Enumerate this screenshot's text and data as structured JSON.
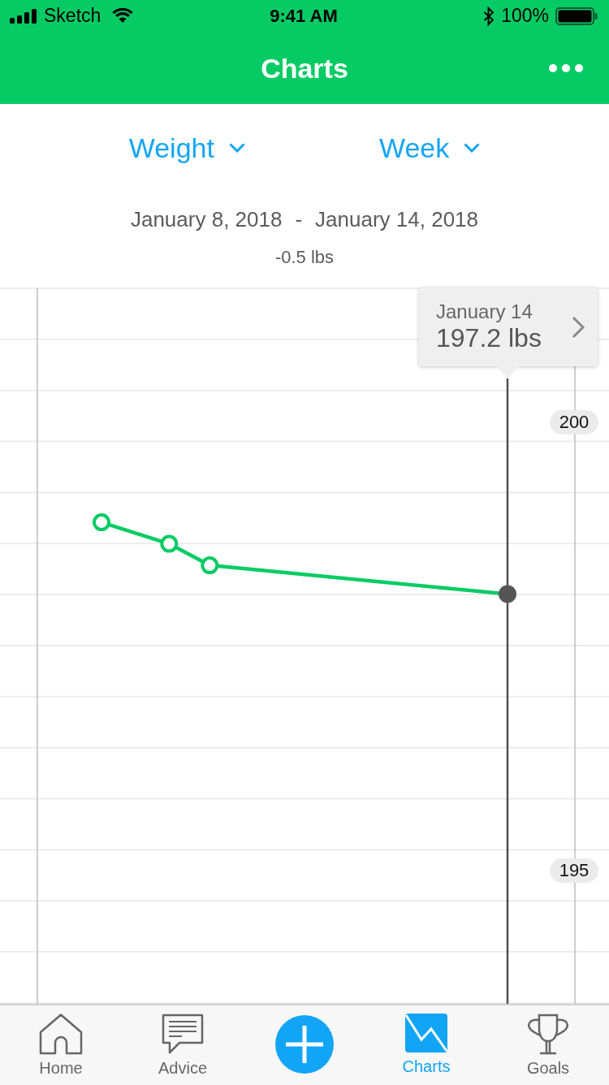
{
  "status_bar": {
    "carrier": "Sketch",
    "time": "9:41 AM",
    "battery": "100%"
  },
  "nav_bar": {
    "title": "Charts"
  },
  "selectors": [
    {
      "label": "Weight"
    },
    {
      "label": "Week"
    }
  ],
  "date_range": {
    "start": "January 8, 2018",
    "separator": "-",
    "end": "January 14, 2018"
  },
  "change": "-0.5 lbs",
  "chart": {
    "tooltip": {
      "date": "January 14",
      "value": "197.2 lbs"
    },
    "points": [
      {
        "selected": false
      },
      {
        "selected": false
      },
      {
        "selected": false
      },
      {
        "selected": true
      }
    ],
    "chart_data": {
      "type": "line",
      "categories": [
        null,
        null,
        null,
        null,
        null,
        null,
        null,
        null,
        null,
        null,
        null,
        null,
        null,
        null,
        null,
        null,
        null,
        null,
        null,
        null,
        null,
        null,
        null,
        null,
        null,
        null,
        null,
        null,
        null,
        null,
        null,
        null,
        null,
        null,
        null,
        null,
        null,
        null,
        null,
        null,
        null,
        null,
        null,
        null,
        null
      ],
      "ylim": [
        193.51,
        201.49
      ],
      "yticks": [
        {
          "value": 200,
          "label": "200"
        },
        {
          "value": 195,
          "label": "195"
        }
      ],
      "series": [
        {
          "color": "#06cb64",
          "marker": "circle",
          "values": [
            null,
            null,
            null,
            null,
            null,
            null,
            null,
            198.88,
            null,
            null,
            null,
            null,
            198.64,
            null,
            null,
            198.4,
            null,
            null,
            null,
            null,
            null,
            null,
            null,
            null,
            null,
            null,
            null,
            null,
            null,
            null,
            null,
            null,
            null,
            null,
            null,
            null,
            null,
            198.08,
            null,
            null,
            null,
            null,
            null,
            null,
            null
          ]
        }
      ]
    }
  },
  "tab_bar": {
    "items": [
      {
        "kind": "tab",
        "label": "Home",
        "selected": false
      },
      {
        "kind": "tab",
        "label": "Advice",
        "selected": false
      },
      {
        "kind": "add"
      },
      {
        "kind": "tab",
        "label": "Charts",
        "selected": true
      },
      {
        "kind": "tab",
        "label": "Goals",
        "selected": false
      }
    ]
  }
}
